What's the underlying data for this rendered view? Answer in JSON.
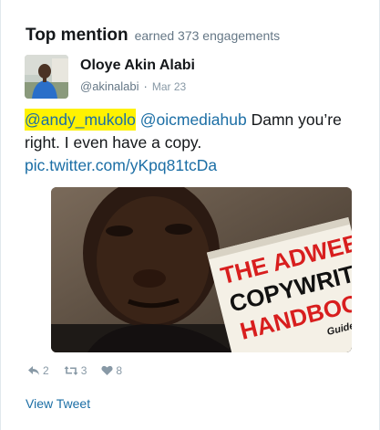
{
  "header": {
    "title": "Top mention",
    "subtitle": "earned 373 engagements"
  },
  "tweet": {
    "author_name": "Oloye Akin Alabi",
    "handle": "@akinalabi",
    "separator": "·",
    "date": "Mar 23",
    "mention1": "@andy_mukolo",
    "mention2": "@oicmediahub",
    "text_after": " Damn you’re right. I even have a copy.",
    "link": "pic.twitter.com/yKpq81tcDa",
    "highlight_color": "#fff200"
  },
  "media": {
    "book_line1": "THE ADWEEK",
    "book_line2": "COPYWRITING",
    "book_line3": "HANDBOOK",
    "book_tagline": "Guide t"
  },
  "actions": {
    "reply_icon": "reply-icon",
    "reply_count": "2",
    "retweet_icon": "retweet-icon",
    "retweet_count": "3",
    "like_icon": "heart-icon",
    "like_count": "8"
  },
  "footer": {
    "view_tweet": "View Tweet"
  },
  "colors": {
    "link": "#1b6ea5",
    "muted": "#657786",
    "highlight": "#fff200"
  }
}
